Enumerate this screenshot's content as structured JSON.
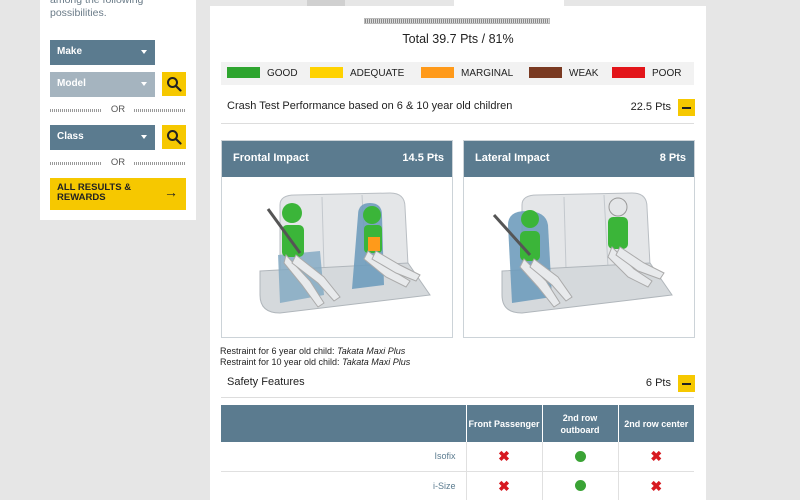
{
  "sidebar": {
    "intro": "among the following possibilities.",
    "make_label": "Make",
    "model_label": "Model",
    "class_label": "Class",
    "or_1": "OR",
    "or_2": "OR",
    "all_results_label": "ALL RESULTS & REWARDS"
  },
  "summary": {
    "total": "Total 39.7 Pts / 81%"
  },
  "legend": [
    {
      "label": "GOOD",
      "color": "#2ea52f"
    },
    {
      "label": "ADEQUATE",
      "color": "#ffd200"
    },
    {
      "label": "MARGINAL",
      "color": "#ff9a1a"
    },
    {
      "label": "WEAK",
      "color": "#7a3a22"
    },
    {
      "label": "POOR",
      "color": "#e3151a"
    }
  ],
  "crash": {
    "title": "Crash Test Performance based on 6 & 10 year old children",
    "points": "22.5 Pts"
  },
  "frontal": {
    "title": "Frontal Impact",
    "points": "14.5 Pts"
  },
  "lateral": {
    "title": "Lateral Impact",
    "points": "8 Pts"
  },
  "restraint": {
    "six_label": "Restraint for 6 year old child:",
    "six_value": "Takata Maxi Plus",
    "ten_label": "Restraint for 10 year old child:",
    "ten_value": "Takata Maxi Plus"
  },
  "safety": {
    "title": "Safety Features",
    "points": "6 Pts",
    "columns": [
      "Front Passenger",
      "2nd row outboard",
      "2nd row center"
    ],
    "rows": [
      {
        "label": "Isofix",
        "values": [
          "x",
          "dot",
          "x"
        ]
      },
      {
        "label": "i-Size",
        "values": [
          "x",
          "dot",
          "x"
        ]
      }
    ]
  },
  "colors": {
    "accent": "#f6c800",
    "header": "#5b7b8f",
    "good": "#3aa335",
    "poor": "#d71920"
  }
}
